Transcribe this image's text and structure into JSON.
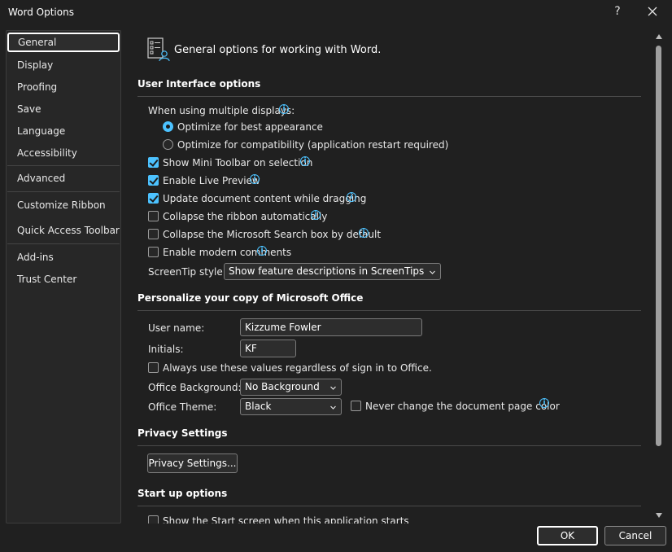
{
  "window": {
    "title": "Word Options",
    "help": "?"
  },
  "nav": {
    "items": [
      "General",
      "Display",
      "Proofing",
      "Save",
      "Language",
      "Accessibility",
      "Advanced",
      "Customize Ribbon",
      "Quick Access Toolbar",
      "Add-ins",
      "Trust Center"
    ],
    "selected": "General"
  },
  "header": {
    "text": "General options for working with Word."
  },
  "ui_options": {
    "title": "User Interface options",
    "multi_display_label": "When using multiple displays:",
    "radio_best": "Optimize for best appearance",
    "radio_compat": "Optimize for compatibility (application restart required)",
    "radio_selected": "best",
    "checkboxes": [
      {
        "label": "Show Mini Toolbar on selection",
        "checked": true,
        "info": true
      },
      {
        "label": "Enable Live Preview",
        "checked": true,
        "info": true
      },
      {
        "label": "Update document content while dragging",
        "checked": true,
        "info": true
      },
      {
        "label": "Collapse the ribbon automatically",
        "checked": false,
        "info": true
      },
      {
        "label": "Collapse the Microsoft Search box by default",
        "checked": false,
        "info": true
      },
      {
        "label": "Enable modern comments",
        "checked": false,
        "info": true
      }
    ],
    "screentip_label": "ScreenTip style:",
    "screentip_value": "Show feature descriptions in ScreenTips"
  },
  "personalize": {
    "title": "Personalize your copy of Microsoft Office",
    "username_label": "User name:",
    "username_value": "Kizzume Fowler",
    "initials_label": "Initials:",
    "initials_value": "KF",
    "always_use_label": "Always use these values regardless of sign in to Office.",
    "always_use_checked": false,
    "background_label": "Office Background:",
    "background_value": "No Background",
    "theme_label": "Office Theme:",
    "theme_value": "Black",
    "never_change_label": "Never change the document page color",
    "never_change_checked": false
  },
  "privacy": {
    "title": "Privacy Settings",
    "button": "Privacy Settings..."
  },
  "startup": {
    "title": "Start up options",
    "show_start_label": "Show the Start screen when this application starts"
  },
  "footer": {
    "ok": "OK",
    "cancel": "Cancel"
  },
  "colors": {
    "accent": "#4cc2ff",
    "background": "#202020",
    "panel": "#272727"
  },
  "icons": [
    "help-icon",
    "close-icon",
    "general-options-icon",
    "info-icon",
    "chevron-down-icon",
    "scroll-up-icon",
    "scroll-down-icon"
  ]
}
